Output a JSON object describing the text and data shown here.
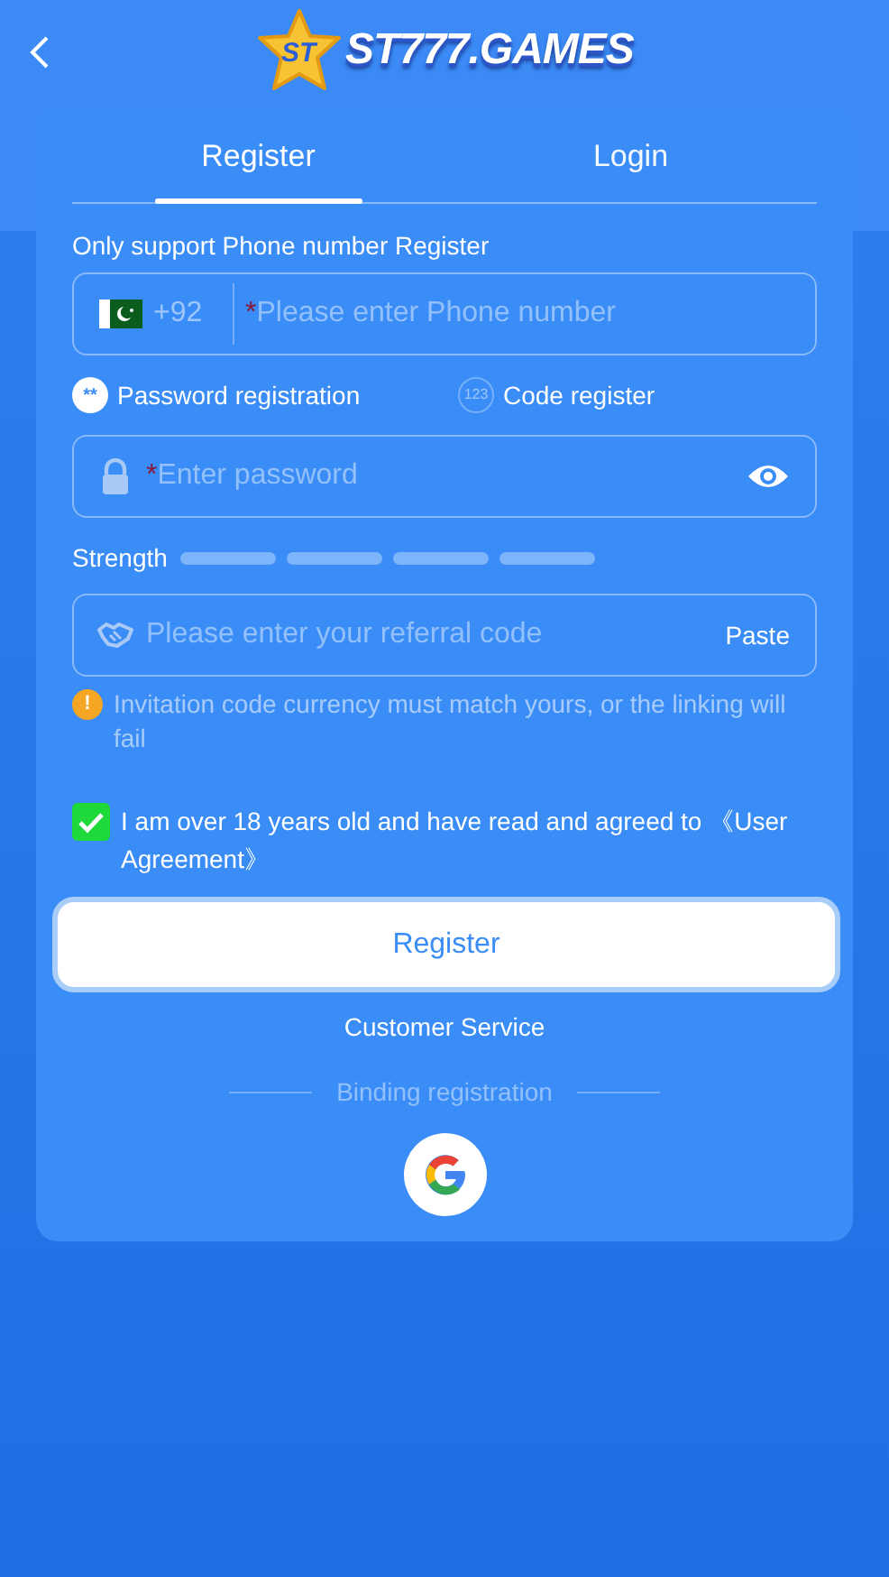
{
  "header": {
    "logo_badge": "ST",
    "logo_text": "ST777.GAMES"
  },
  "tabs": [
    {
      "label": "Register",
      "selected": true
    },
    {
      "label": "Login",
      "selected": false
    }
  ],
  "notice": "Only support Phone number Register",
  "phone": {
    "country_code": "+92",
    "required_mark": "*",
    "placeholder": "Please enter Phone number"
  },
  "methods": [
    {
      "kind": "password",
      "icon_text": "**",
      "label": "Password registration",
      "selected": true
    },
    {
      "kind": "code",
      "icon_text": "123",
      "label": "Code register",
      "selected": false
    }
  ],
  "password": {
    "required_mark": "*",
    "placeholder": "Enter password"
  },
  "strength": {
    "label": "Strength"
  },
  "referral": {
    "placeholder": "Please enter your referral code",
    "paste": "Paste"
  },
  "warning": {
    "icon_text": "!",
    "text": "Invitation code currency must match yours, or the linking will fail"
  },
  "agreement": {
    "checked": true,
    "text": "I am over 18 years old and have read and agreed to 《User Agreement》"
  },
  "register_button": "Register",
  "customer_service": "Customer Service",
  "binding": "Binding registration"
}
